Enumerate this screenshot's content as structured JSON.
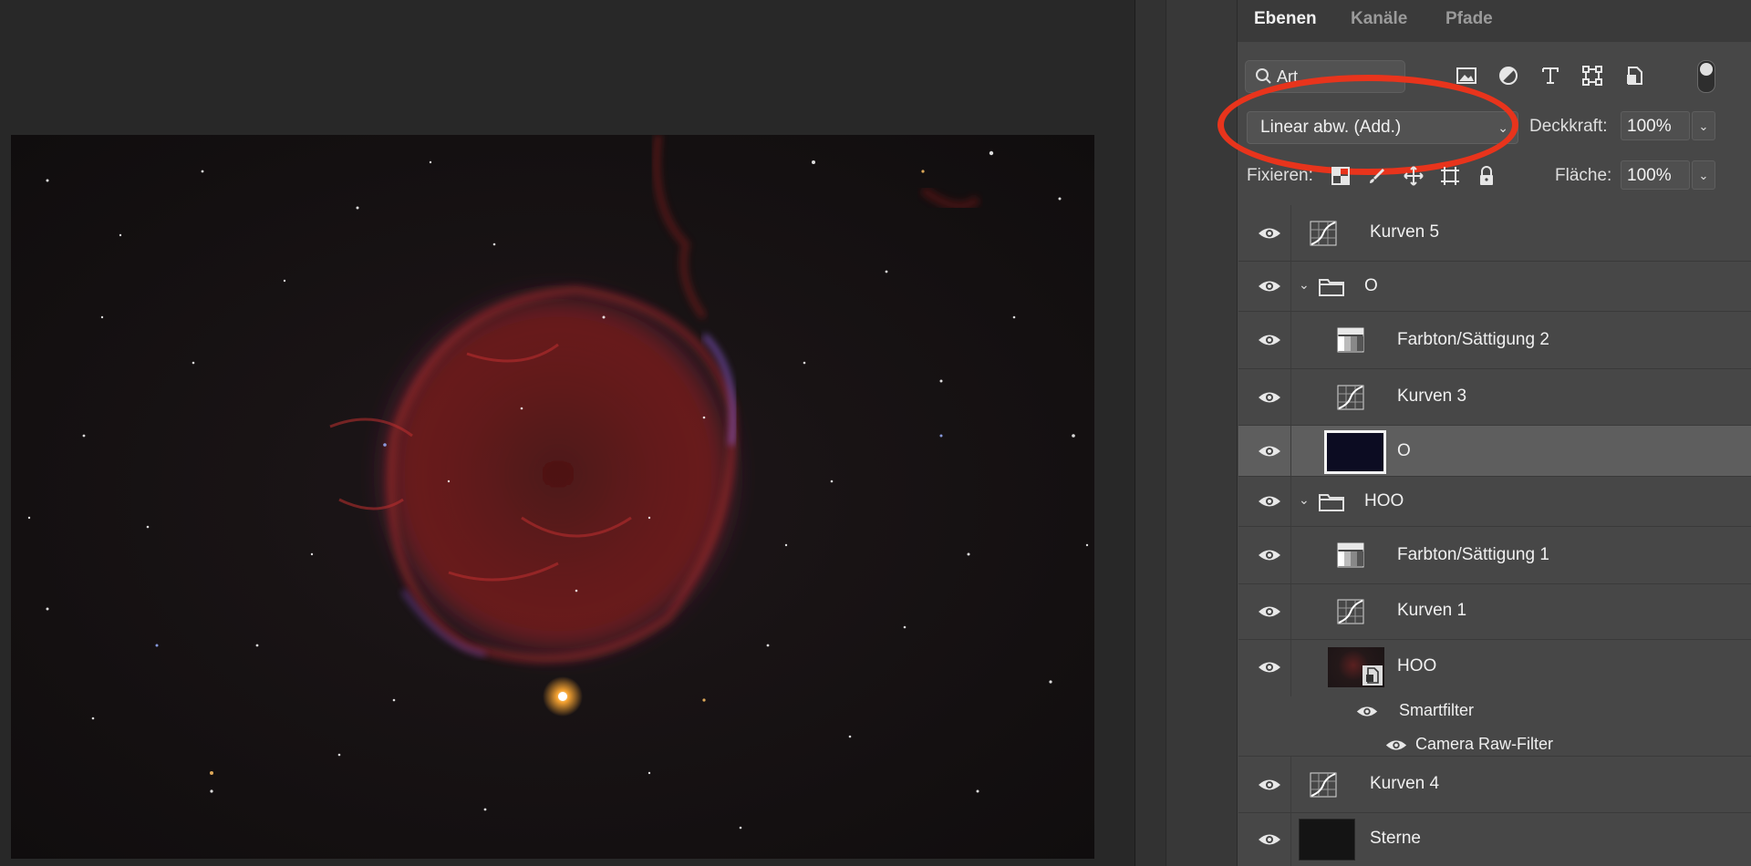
{
  "panel": {
    "tabs": [
      "Ebenen",
      "Kanäle",
      "Pfade"
    ],
    "search": {
      "value": "Art",
      "icon": "search-icon"
    },
    "filter_icons": [
      "image-filter-icon",
      "adjustment-filter-icon",
      "type-filter-icon",
      "shape-filter-icon",
      "smart-object-filter-icon"
    ],
    "blend_mode": "Linear abw. (Add.)",
    "opacity_label": "Deckkraft:",
    "opacity_value": "100%",
    "lock_label": "Fixieren:",
    "lock_icons": [
      "lock-transparency-icon",
      "lock-pixels-icon",
      "lock-position-icon",
      "lock-artboard-icon",
      "lock-all-icon"
    ],
    "fill_label": "Fläche:",
    "fill_value": "100%"
  },
  "layers": [
    {
      "name": "Kurven 5",
      "type": "curves",
      "indent": 0
    },
    {
      "name": "O",
      "type": "group",
      "indent": 0,
      "expanded": true
    },
    {
      "name": "Farbton/Sättigung 2",
      "type": "hue-saturation",
      "indent": 1
    },
    {
      "name": "Kurven 3",
      "type": "curves",
      "indent": 1
    },
    {
      "name": "O",
      "type": "pixel",
      "indent": 1,
      "selected": true
    },
    {
      "name": "HOO",
      "type": "group",
      "indent": 0,
      "expanded": true
    },
    {
      "name": "Farbton/Sättigung 1",
      "type": "hue-saturation",
      "indent": 1
    },
    {
      "name": "Kurven 1",
      "type": "curves",
      "indent": 1
    },
    {
      "name": "HOO",
      "type": "smart-object",
      "indent": 1,
      "smart_filters": {
        "label": "Smartfilter",
        "filters": [
          "Camera Raw-Filter"
        ]
      }
    },
    {
      "name": "Kurven 4",
      "type": "curves",
      "indent": 0
    },
    {
      "name": "Sterne",
      "type": "pixel",
      "indent": 0
    }
  ],
  "colors": {
    "annotation_ring": "#e8341c",
    "panel_bg": "#474747",
    "selected_row": "#5e5e5e"
  }
}
